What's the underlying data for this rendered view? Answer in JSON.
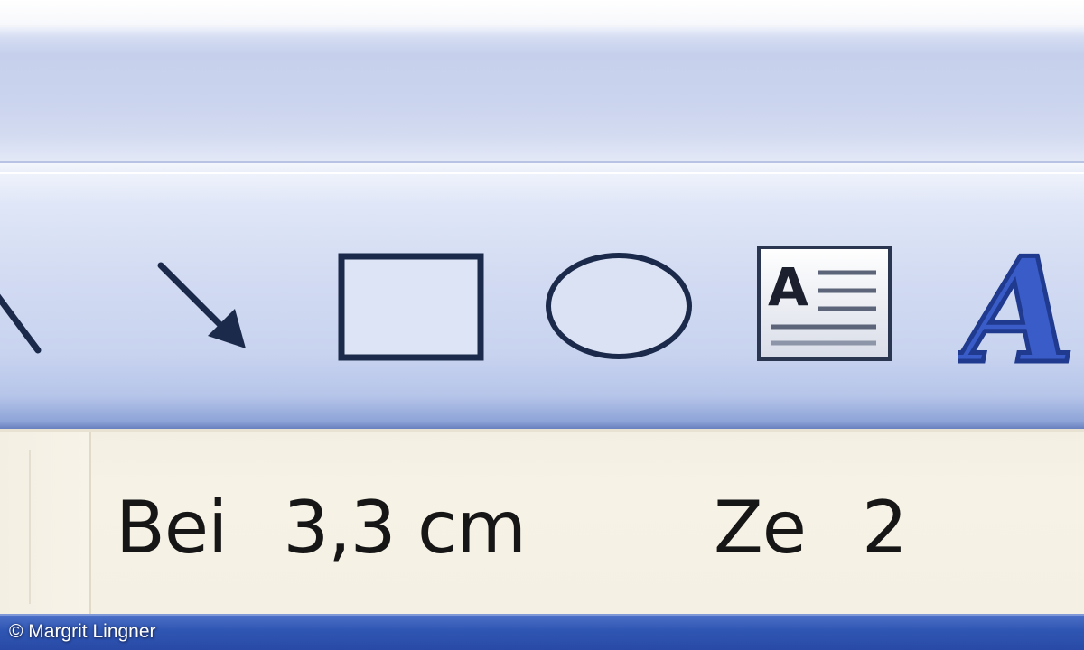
{
  "drawing_toolbar": {
    "tools": [
      {
        "icon": "line-icon"
      },
      {
        "icon": "arrow-icon"
      },
      {
        "icon": "rectangle-icon"
      },
      {
        "icon": "oval-icon"
      },
      {
        "icon": "text-box-icon",
        "glyph": "A"
      },
      {
        "icon": "wordart-icon",
        "glyph": "A"
      }
    ]
  },
  "status_bar": {
    "position_label": "Bei",
    "position_value": "3,3 cm",
    "line_label": "Ze",
    "line_value": "2"
  },
  "credit": "© Margrit Lingner",
  "colors": {
    "toolbar": "#c8d3ef",
    "status_bar": "#f4f0e3",
    "taskbar": "#2f56b3",
    "icon_stroke": "#1b2a4a"
  }
}
